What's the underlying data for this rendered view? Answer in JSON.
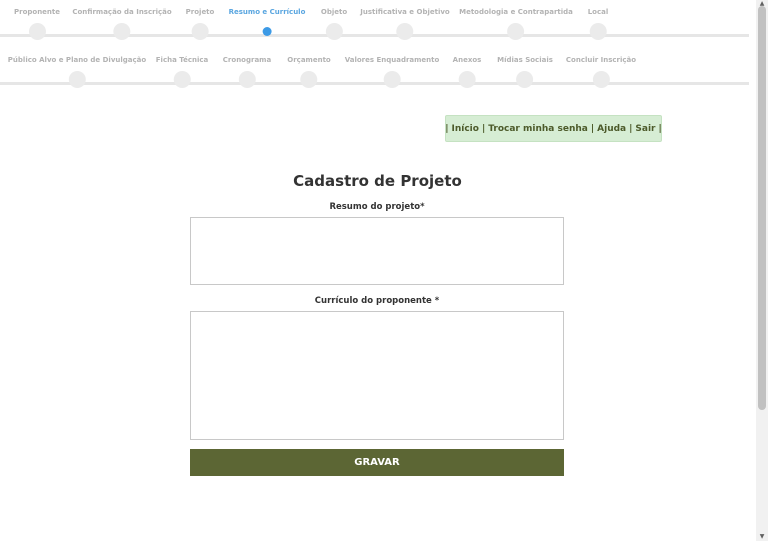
{
  "wizard": {
    "row1": [
      {
        "label": "Proponente",
        "active": false
      },
      {
        "label": "Confirmação da Inscrição",
        "active": false
      },
      {
        "label": "Projeto",
        "active": false
      },
      {
        "label": "Resumo e Currículo",
        "active": true
      },
      {
        "label": "Objeto",
        "active": false
      },
      {
        "label": "Justificativa e Objetivo",
        "active": false
      },
      {
        "label": "Metodologia e Contrapartida",
        "active": false
      },
      {
        "label": "Local",
        "active": false
      }
    ],
    "row2": [
      {
        "label": "Público Alvo e Plano de Divulgação",
        "active": false
      },
      {
        "label": "Ficha Técnica",
        "active": false
      },
      {
        "label": "Cronograma",
        "active": false
      },
      {
        "label": "Orçamento",
        "active": false
      },
      {
        "label": "Valores Enquadramento",
        "active": false
      },
      {
        "label": "Anexos",
        "active": false
      },
      {
        "label": "Mídias Sociais",
        "active": false
      },
      {
        "label": "Concluir Inscrição",
        "active": false
      }
    ]
  },
  "user_menu": {
    "separator": "|",
    "inicio": "Início",
    "trocar_senha": "Trocar minha senha",
    "ajuda": "Ajuda",
    "sair": "Sair"
  },
  "form": {
    "title": "Cadastro de Projeto",
    "resumo_label": "Resumo do projeto*",
    "resumo_value": "",
    "curriculo_label": "Currículo do proponente *",
    "curriculo_value": "",
    "save_label": "GRAVAR"
  },
  "colors": {
    "active_step": "#3c9ae6",
    "menu_bg": "#d6edd4",
    "save_button": "#5c6634"
  }
}
